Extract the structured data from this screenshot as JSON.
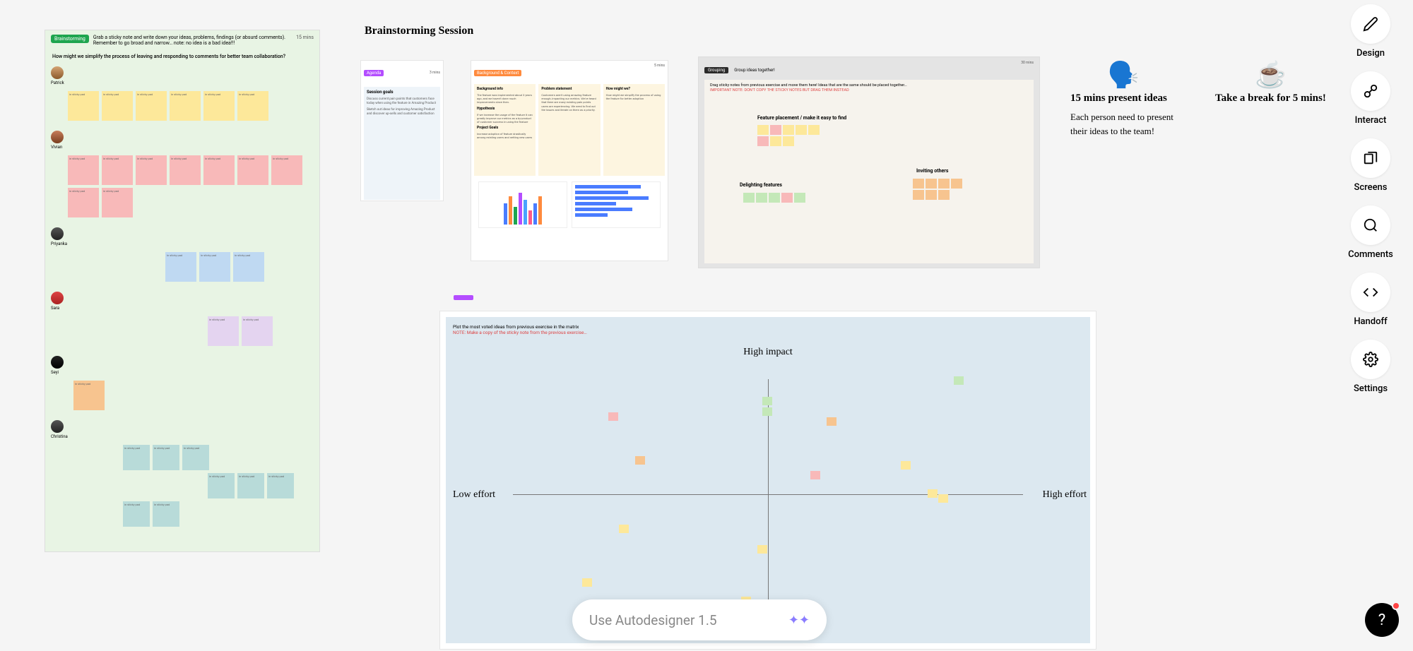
{
  "sidebar": {
    "design": "Design",
    "interact": "Interact",
    "screens": "Screens",
    "comments": "Comments",
    "handoff": "Handoff",
    "settings": "Settings"
  },
  "help": "?",
  "autodesigner": {
    "placeholder": "Use Autodesigner 1.5"
  },
  "title": "Brainstorming Session",
  "brainstorm": {
    "tag": "Brainstorming",
    "instruction": "Grab a sticky note and write down your ideas, problems, findings (or absurd comments). Remember to go broad and narrow… note: no idea is a bad idea!!!",
    "timer": "15 mins",
    "question": "How might we simplify the process of leaving and responding to comments for better team collaboration?",
    "people": [
      "Patrick",
      "Vivian",
      "Priyanka",
      "Sara",
      "Seyi",
      "Christina"
    ],
    "sticky_label": "in sticky pad"
  },
  "agenda": {
    "tag": "Agenda",
    "timer": "3 mins",
    "title": "Session goals",
    "lines": [
      "Discuss current pain points that customers face today when using the feature in Amazing Product",
      "Sketch out ideas for improving Amazing Product and discover up-sells and customer satisfaction"
    ]
  },
  "background": {
    "tag": "Background & Context",
    "timer": "5 mins",
    "col1_title": "Background info",
    "col1_text": "The feature was implemented about 3 years ago, and we haven't done much improvements since then.",
    "col1_h2": "Hypothesis",
    "col1_h2_text": "If we increase the usage of the feature it can greatly improve our metrics as a by-product of customer success in using the feature",
    "col1_h3": "Project Goals",
    "col1_h3_text": "Increase adoption of feature drastically among existing users and netting new users",
    "col2_title": "Problem statement",
    "col2_text": "Customers aren't using amazing feature enough, impacting our metrics. We've heard that there are many existing pain points users are experiencing. We need to find out the issues and iterate on them as a priority.",
    "col3_title": "How might we?",
    "col3_text": "How might we simplify the process of using the feature for better adoption"
  },
  "grouping": {
    "tag": "Grouping",
    "title": "Group ideas together!",
    "timer": "30 mins",
    "instr1": "Drag sticky notes from previous exercise and move them here! Ideas that are the same should be placed together…",
    "instr2": "IMPORTANT NOTE: DON'T COPY THE STICKY NOTES BUT DRAG THEM INSTEAD",
    "cluster1": "Feature placement / make it easy to find",
    "cluster2": "Delighting features",
    "cluster3": "Inviting others"
  },
  "info1": {
    "title": "15 mins present ideas",
    "desc": "Each person need to present their ideas to the team!"
  },
  "info2": {
    "title": "Take a break for 5 mins!"
  },
  "matrix": {
    "instr1": "Plot the most voted ideas from previous exercise in the matrix",
    "instr2": "NOTE: Make a copy of the sticky note from the previous exercise…",
    "top": "High impact",
    "left": "Low effort",
    "right": "High effort"
  }
}
